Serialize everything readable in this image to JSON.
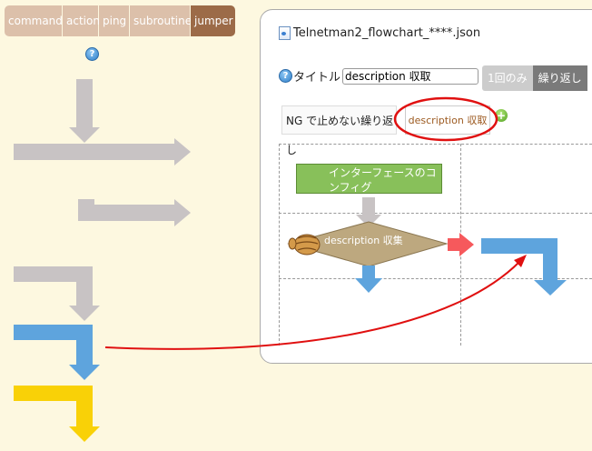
{
  "tabs": [
    {
      "label": "command"
    },
    {
      "label": "action"
    },
    {
      "label": "ping"
    },
    {
      "label": "subroutine"
    },
    {
      "label": "jumper"
    }
  ],
  "help_glyph": "?",
  "file": {
    "name": "Telnetman2_flowchart_****.json"
  },
  "title_field": {
    "label": "タイトル",
    "value": "description 収取"
  },
  "mode": {
    "once": "1回のみ",
    "repeat": "繰り返し"
  },
  "ng_label": "NG で止めない繰り返し",
  "desc_label": "description 収取",
  "add_glyph": "+",
  "nodes": {
    "interface": "インターフェースのコンフィグ",
    "collect": "description 収集"
  },
  "colors": {
    "background": "#fdf8e0",
    "tab": "#dcc0aa",
    "tab_active": "#9c6b48",
    "gray_arrow": "#c8c3c4",
    "blue_arrow": "#5ea4dd",
    "yellow_arrow": "#f9d107",
    "red_arrow": "#f6595c",
    "annotation_red": "#e01010"
  },
  "icons": [
    "help-icon",
    "file-icon",
    "add-icon",
    "roll-cake-icon",
    "croissant-icon"
  ]
}
